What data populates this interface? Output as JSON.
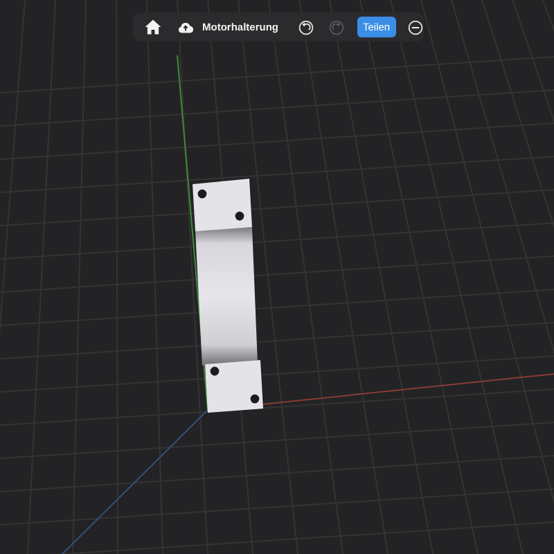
{
  "toolbar": {
    "title": "Motorhalterung",
    "history": [
      {
        "kind": "undo",
        "disabled": false
      },
      {
        "kind": "redo",
        "disabled": true
      }
    ],
    "share": {
      "label": "Teilen"
    }
  }
}
